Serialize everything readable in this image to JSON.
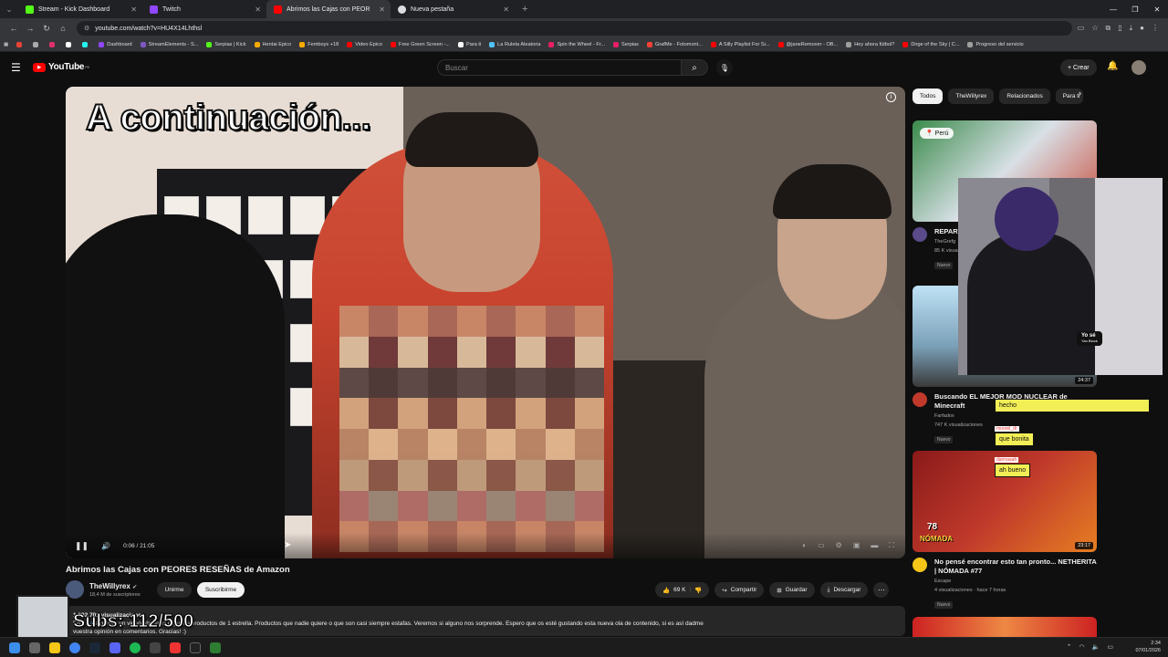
{
  "browser": {
    "tabs": [
      {
        "title": "Stream - Kick Dashboard",
        "color": "#53fc18",
        "active": false
      },
      {
        "title": "Twitch",
        "color": "#9146ff",
        "active": false
      },
      {
        "title": "Abrimos las Cajas con PEOR",
        "color": "#ff0000",
        "active": true
      },
      {
        "title": "Nueva pestaña",
        "color": "#dadce0",
        "active": false
      }
    ],
    "url": "youtube.com/watch?v=HU4X14Lhthsl",
    "bookmarks": [
      {
        "label": "Dashboard",
        "color": "#9146ff"
      },
      {
        "label": "StreamElements - S...",
        "color": "#7e57c2"
      },
      {
        "label": "Serpias | Kick",
        "color": "#53fc18"
      },
      {
        "label": "Hentai Epico",
        "color": "#f9ab00"
      },
      {
        "label": "Femboys +18",
        "color": "#f9ab00"
      },
      {
        "label": "Video Epico",
        "color": "#ff0000"
      },
      {
        "label": "Free Green Screen -...",
        "color": "#ff0000"
      },
      {
        "label": "Para ti",
        "color": "#ffffff"
      },
      {
        "label": "La Ruleta Aleatoria",
        "color": "#4fc3f7"
      },
      {
        "label": "Spin the Wheel - Fr...",
        "color": "#e91e63"
      },
      {
        "label": "Serpias",
        "color": "#e91e63"
      },
      {
        "label": "GrafMe - Fotomont...",
        "color": "#f44336"
      },
      {
        "label": "A Silly Playlist For Si...",
        "color": "#ff0000"
      },
      {
        "label": "@janeRemover - OB...",
        "color": "#ff0000"
      },
      {
        "label": "Hey ahora fútbol?",
        "color": "#9e9e9e"
      },
      {
        "label": "Dirge of the Sky | C...",
        "color": "#ff0000"
      },
      {
        "label": "Progreso del servicio",
        "color": "#9e9e9e"
      }
    ]
  },
  "youtube": {
    "logo": "YouTube",
    "logo_country": "PE",
    "search_placeholder": "Buscar",
    "create_label": "Crear",
    "player": {
      "overlay_title": "A continuación...",
      "time": "0:06 / 21:05"
    },
    "video": {
      "title": "Abrimos las Cajas con PEORES RESEÑAS de Amazon",
      "channel": "TheWillyrex",
      "subscribers": "18,4 M de suscriptores",
      "join_label": "Unirme",
      "subscribe_label": "Suscribirme",
      "likes": "69 K",
      "share_label": "Compartir",
      "save_label": "Guardar",
      "download_label": "Descargar",
      "description_stats": "1.002.701 visualizaciones",
      "description_prefix": "En",
      "description_link": "mha",
      "description_text": "a grabar un video abriendo cajas de productos de 1 estrella. Productos que nadie quiere o que son casi siempre estafas. Veremos si alguno nos sorprende. Espero que os esté gustando esta nueva ola de contenido, si es así dadme",
      "description_line2": "vuestra opinión en comentarios. Gracias! :)"
    },
    "chips": [
      "Todos",
      "TheWillyrex",
      "Relacionados",
      "Para ti"
    ],
    "related": [
      {
        "title": "REPARTI... POR NA...",
        "channel": "TheGrefg",
        "stats": "85 K visualiz...",
        "badge": "Nuevo",
        "location": "Perú",
        "duration": ""
      },
      {
        "title": "Buscando EL MEJOR MOD NUCLEAR de Minecraft",
        "channel": "Farfadox",
        "stats": "747 K visualizaciones",
        "badge": "Nuevo",
        "duration": "24:37"
      },
      {
        "title": "No pensé encontrar esto tan pronto... NETHERITA | NÓMADA #77",
        "channel": "Escape",
        "stats": "4 visualizaciones · hace 7 horas",
        "badge": "Nuevo",
        "duration": "23:17",
        "thumb_number": "78",
        "thumb_word": "NÓMADA"
      }
    ]
  },
  "stream_overlay": {
    "subs_goal": "Subs: 112/500",
    "webcam_label": "Yo sé",
    "webcam_sublabel": "Yan Block",
    "chat": [
      {
        "user": "",
        "text": "hecho"
      },
      {
        "user": "moorel_dr",
        "text": "que bonita"
      },
      {
        "user": "dannaaah",
        "text": "ah bueno"
      }
    ]
  },
  "taskbar": {
    "time": "2:34",
    "date": "07/01/2026"
  }
}
